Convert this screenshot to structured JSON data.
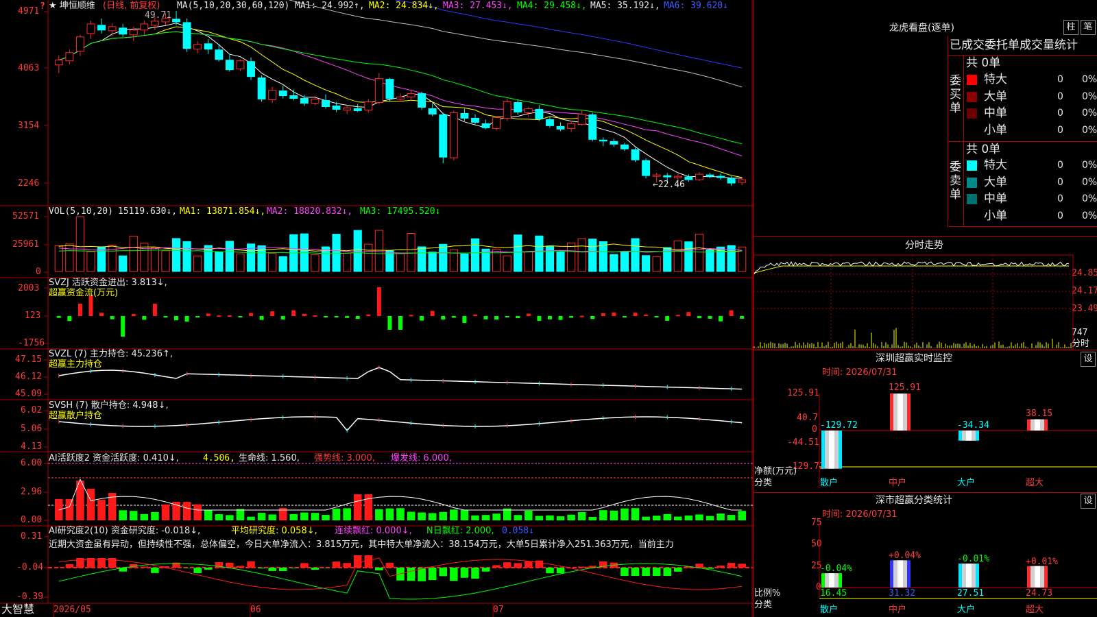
{
  "colors": {
    "up": "#ff2a2a",
    "down": "#00ffff",
    "grid": "#b00000",
    "ma1": "#ffffff",
    "ma2": "#ffff00",
    "ma3": "#ff44ff",
    "ma4": "#00ff00",
    "ma5": "#c0c0c0",
    "ma6": "#3333ff"
  },
  "top_icon": "?",
  "stock": {
    "name": "★ 坤恒顺维",
    "period": "(日线, 前复权)"
  },
  "main": {
    "ma_params": "MA(5,10,20,30,60,120)",
    "ma1": "MA1: 24.992↑,",
    "ma2": "MA2: 24.834↓,",
    "ma3": "MA3: 27.453↓,",
    "ma4": "MA4: 29.458↓,",
    "ma5": "MA5: 35.192↓,",
    "ma6": "MA6: 39.620↓",
    "yticks": [
      "4971",
      "4063",
      "3154",
      "2246"
    ],
    "high_label": "49.71",
    "low_label": "←22.46"
  },
  "vol": {
    "header": "VOL(5,10,20)",
    "value": "15119.630↓,",
    "ma1": "MA1: 13871.854↓,",
    "ma2": "MA2: 18820.832↓,",
    "ma3": "MA3: 17495.520↓",
    "yticks": [
      "52571",
      "25961",
      "0"
    ]
  },
  "svzj": {
    "header": "SVZJ  活跃资金进出: 3.813↓,",
    "sub": "超赢资金流(万元)",
    "yticks": [
      "2003",
      "123",
      "-1756"
    ]
  },
  "svzl": {
    "header": "SVZL (7) 主力持仓: 45.236↑,",
    "sub": "超赢主力持仓",
    "yticks": [
      "47.15",
      "46.12",
      "45.09"
    ]
  },
  "svsh": {
    "header": "SVSH (7) 散户持仓: 4.948↓,",
    "sub": "超赢散户持仓",
    "yticks": [
      "6.02",
      "5.06",
      "4.13"
    ]
  },
  "ai1": {
    "header": "AI活跃度2 资金活跃度: 0.410↓,",
    "v2": "4.506,",
    "life": "生命线: 1.560,",
    "strong": "强势线: 3.000,",
    "burst": "爆发线: 6.000,",
    "yticks": [
      "6.00",
      "2.96",
      "0.00"
    ]
  },
  "ai2": {
    "header": "AI研究度2(10) 资金研究度: -0.018↓,",
    "avg": "平均研究度: 0.058↓,",
    "lian": "连续飘红: 0.000↓,",
    "nday": "N日飘红: 2.000,",
    "last": "0.058↓",
    "text": "近期大资金虽有异动，但持续性不强，总体偏空，今日大单净流入：3.815万元，其中特大单净流入：38.154万元，大单5日累计净入251.363万元，当前主力",
    "yticks": [
      "0.31",
      "-0.04",
      "-0.39"
    ]
  },
  "xaxis": {
    "logo": "大智慧",
    "labels": [
      "2026/05",
      "06",
      "07"
    ]
  },
  "longhu": {
    "title": "龙虎看盘(逐单)",
    "btn1": "柱",
    "btn2": "笔",
    "stats_title": "已成交委托单成交量统计",
    "buy": {
      "label": "委买单",
      "total": "共 0单",
      "rows": [
        {
          "name": "特大",
          "count": "0",
          "pct": "0%",
          "color": "#ff0000"
        },
        {
          "name": "大单",
          "count": "0",
          "pct": "0%",
          "color": "#8b0000"
        },
        {
          "name": "中单",
          "count": "0",
          "pct": "0%",
          "color": "#6b0000"
        },
        {
          "name": "小单",
          "count": "0",
          "pct": "0%",
          "color": "#000000"
        }
      ]
    },
    "sell": {
      "label": "委卖单",
      "total": "共 0单",
      "rows": [
        {
          "name": "特大",
          "count": "0",
          "pct": "0%",
          "color": "#00ffff"
        },
        {
          "name": "大单",
          "count": "0",
          "pct": "0%",
          "color": "#008b8b"
        },
        {
          "name": "中单",
          "count": "0",
          "pct": "0%",
          "color": "#007070"
        },
        {
          "name": "小单",
          "count": "0",
          "pct": "0%",
          "color": "#000000"
        }
      ]
    }
  },
  "fenshi": {
    "title": "分时走势",
    "yticks": [
      "24.85",
      "24.17",
      "23.49"
    ],
    "vol_label": "747",
    "unit": "分时"
  },
  "monitor": {
    "title": "深圳超赢实时监控",
    "btn": "设",
    "time": "时间: 2026/07/31",
    "yticks": [
      "125.91",
      "40.7",
      "0",
      "-44.51",
      "-129.72"
    ],
    "ylabel": "净额(万元)",
    "xlabel": "分类",
    "bars": [
      {
        "name": "散户",
        "value": -129.72,
        "label": "-129.72"
      },
      {
        "name": "中户",
        "value": 125.91,
        "label": "125.91"
      },
      {
        "name": "大户",
        "value": -34.34,
        "label": "-34.34"
      },
      {
        "name": "超大",
        "value": 38.15,
        "label": "38.15"
      }
    ]
  },
  "stat": {
    "title": "深市超赢分类统计",
    "btn": "设",
    "time": "时间: 2026/07/31",
    "yticks": [
      "75",
      "50",
      "25",
      "0"
    ],
    "ylabel": "比例%",
    "xlabel": "分类",
    "bars": [
      {
        "name": "散户",
        "value": 16.45,
        "change": "-0.04%"
      },
      {
        "name": "中户",
        "value": 31.32,
        "change": "+0.04%"
      },
      {
        "name": "大户",
        "value": 27.51,
        "change": "-0.01%"
      },
      {
        "name": "超大",
        "value": 24.73,
        "change": "+0.01%"
      }
    ]
  },
  "chart_data": {
    "type": "candlestick",
    "dates": [
      "2026/05",
      "06",
      "07"
    ],
    "ohlc_approx": [
      [
        41.8,
        43.2,
        40.6,
        42.5
      ],
      [
        42.4,
        44.0,
        41.9,
        43.6
      ],
      [
        43.8,
        46.2,
        43.1,
        45.9
      ],
      [
        46.4,
        48.3,
        45.6,
        47.8
      ],
      [
        47.6,
        48.6,
        46.4,
        46.9
      ],
      [
        46.8,
        47.9,
        46.0,
        47.4
      ],
      [
        47.2,
        47.8,
        45.9,
        46.3
      ],
      [
        46.2,
        47.4,
        45.3,
        46.9
      ],
      [
        46.9,
        48.3,
        46.2,
        47.8
      ],
      [
        47.6,
        48.9,
        46.9,
        48.2
      ],
      [
        48.1,
        49.4,
        47.6,
        48.6
      ],
      [
        48.5,
        49.71,
        47.6,
        48.1
      ],
      [
        48.0,
        48.6,
        43.7,
        44.2
      ],
      [
        44.1,
        45.3,
        43.5,
        44.8
      ],
      [
        44.9,
        45.6,
        43.4,
        44.1
      ],
      [
        44.0,
        44.9,
        42.3,
        42.6
      ],
      [
        42.5,
        43.4,
        40.8,
        41.1
      ],
      [
        41.2,
        42.6,
        40.9,
        42.4
      ],
      [
        42.3,
        42.9,
        39.6,
        40.1
      ],
      [
        39.9,
        40.3,
        36.4,
        36.8
      ],
      [
        36.7,
        38.6,
        36.2,
        38.1
      ],
      [
        38.0,
        38.8,
        36.9,
        37.3
      ],
      [
        37.3,
        38.2,
        36.6,
        36.9
      ],
      [
        36.9,
        37.4,
        35.8,
        36.2
      ],
      [
        36.2,
        37.3,
        35.9,
        36.8
      ],
      [
        36.6,
        37.5,
        35.4,
        35.7
      ],
      [
        35.8,
        36.4,
        34.9,
        35.3
      ],
      [
        35.2,
        35.9,
        34.6,
        35.5
      ],
      [
        35.4,
        36.1,
        34.9,
        35.1
      ],
      [
        35.2,
        36.8,
        34.8,
        36.4
      ],
      [
        36.3,
        40.6,
        36.0,
        39.8
      ],
      [
        39.7,
        39.9,
        36.4,
        36.9
      ],
      [
        36.8,
        37.6,
        36.4,
        37.1
      ],
      [
        37.1,
        38.2,
        36.6,
        37.6
      ],
      [
        37.6,
        37.9,
        35.2,
        35.6
      ],
      [
        35.4,
        36.2,
        34.3,
        34.6
      ],
      [
        34.5,
        34.8,
        27.4,
        28.3
      ],
      [
        28.2,
        35.1,
        27.8,
        34.8
      ],
      [
        34.7,
        35.4,
        33.6,
        34.0
      ],
      [
        34.0,
        34.6,
        33.1,
        33.4
      ],
      [
        33.2,
        33.8,
        32.4,
        32.6
      ],
      [
        32.5,
        34.3,
        32.2,
        34.1
      ],
      [
        34.0,
        36.9,
        33.6,
        36.4
      ],
      [
        36.3,
        36.7,
        34.5,
        34.9
      ],
      [
        34.8,
        35.7,
        34.2,
        35.4
      ],
      [
        35.3,
        35.9,
        33.6,
        33.9
      ],
      [
        33.8,
        34.2,
        32.6,
        32.9
      ],
      [
        32.8,
        33.4,
        32.1,
        32.4
      ],
      [
        32.5,
        33.6,
        32.0,
        33.2
      ],
      [
        33.1,
        35.2,
        32.9,
        34.6
      ],
      [
        34.5,
        34.8,
        30.6,
        30.9
      ],
      [
        30.8,
        31.2,
        29.9,
        30.7
      ],
      [
        30.6,
        31.0,
        29.8,
        30.2
      ],
      [
        30.1,
        30.4,
        29.2,
        29.5
      ],
      [
        29.4,
        29.7,
        27.6,
        27.9
      ],
      [
        27.8,
        28.1,
        25.2,
        25.6
      ],
      [
        25.5,
        26.0,
        24.6,
        25.7
      ],
      [
        25.6,
        26.0,
        24.8,
        25.4
      ],
      [
        25.3,
        25.8,
        24.9,
        25.5
      ],
      [
        25.4,
        25.8,
        24.7,
        25.0
      ],
      [
        25.0,
        26.1,
        24.8,
        25.8
      ],
      [
        25.7,
        26.0,
        25.2,
        25.5
      ],
      [
        25.5,
        25.9,
        25.0,
        25.3
      ],
      [
        25.2,
        25.5,
        24.1,
        24.5
      ],
      [
        24.6,
        25.4,
        24.2,
        24.99
      ]
    ],
    "high": 49.71,
    "low": 22.46,
    "ylim": [
      22.0,
      50.5
    ]
  }
}
